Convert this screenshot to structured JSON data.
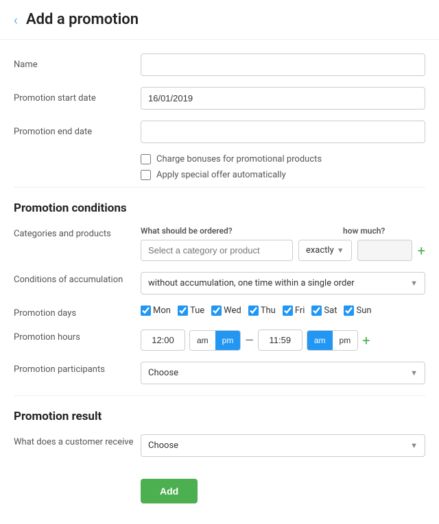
{
  "header": {
    "back_label": "‹",
    "title": "Add a promotion"
  },
  "form": {
    "name_label": "Name",
    "name_placeholder": "",
    "start_date_label": "Promotion start date",
    "start_date_value": "16/01/2019",
    "end_date_label": "Promotion end date",
    "end_date_placeholder": "",
    "charge_bonuses_label": "Charge bonuses for promotional products",
    "apply_special_label": "Apply special offer automatically"
  },
  "conditions": {
    "section_title": "Promotion conditions",
    "categories_label": "Categories and products",
    "what_ordered_label": "What should be ordered?",
    "how_much_label": "how much?",
    "category_placeholder": "Select a category or product",
    "exactly_label": "exactly",
    "quantity_value": "",
    "accumulation_label": "Conditions of accumulation",
    "accumulation_value": "without accumulation, one time within a single order",
    "days_label": "Promotion days",
    "days": [
      {
        "id": "mon",
        "label": "Mon",
        "checked": true
      },
      {
        "id": "tue",
        "label": "Tue",
        "checked": true
      },
      {
        "id": "wed",
        "label": "Wed",
        "checked": true
      },
      {
        "id": "thu",
        "label": "Thu",
        "checked": true
      },
      {
        "id": "fri",
        "label": "Fri",
        "checked": true
      },
      {
        "id": "sat",
        "label": "Sat",
        "checked": true
      },
      {
        "id": "sun",
        "label": "Sun",
        "checked": true
      }
    ],
    "hours_label": "Promotion hours",
    "start_time": "12:00",
    "start_am": false,
    "start_pm": true,
    "end_time": "11:59",
    "end_am": true,
    "end_pm": false,
    "dash": "—",
    "participants_label": "Promotion participants",
    "participants_placeholder": "Choose"
  },
  "result": {
    "section_title": "Promotion result",
    "receives_label": "What does a customer receive",
    "receives_placeholder": "Choose"
  },
  "actions": {
    "add_label": "Add"
  }
}
